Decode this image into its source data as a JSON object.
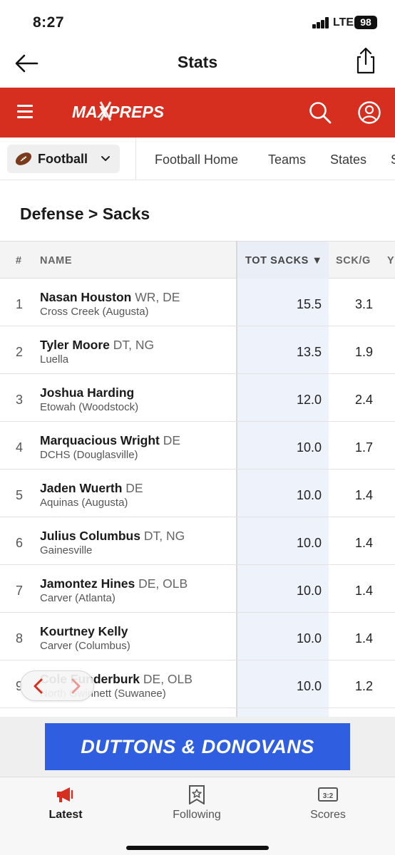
{
  "status_bar": {
    "time": "8:27",
    "network": "LTE",
    "battery": "98"
  },
  "header": {
    "title": "Stats"
  },
  "brand": {
    "logo_text": "MAXPREPS"
  },
  "sport_selector": {
    "selected": "Football",
    "nav_links": [
      "Football Home",
      "Teams",
      "States",
      "S"
    ]
  },
  "section": {
    "title": "Defense > Sacks"
  },
  "table": {
    "columns": {
      "rank": "#",
      "name": "NAME",
      "tot_sacks": "TOT SACKS ▼",
      "sck_g": "SCK/G",
      "next": "Y"
    },
    "rows": [
      {
        "rank": "1",
        "name": "Nasan Houston",
        "pos": "WR, DE",
        "school": "Cross Creek (Augusta)",
        "tot": "15.5",
        "scg": "3.1"
      },
      {
        "rank": "2",
        "name": "Tyler Moore",
        "pos": "DT, NG",
        "school": "Luella",
        "tot": "13.5",
        "scg": "1.9"
      },
      {
        "rank": "3",
        "name": "Joshua Harding",
        "pos": "",
        "school": "Etowah (Woodstock)",
        "tot": "12.0",
        "scg": "2.4"
      },
      {
        "rank": "4",
        "name": "Marquacious Wright",
        "pos": "DE",
        "school": "DCHS (Douglasville)",
        "tot": "10.0",
        "scg": "1.7"
      },
      {
        "rank": "5",
        "name": "Jaden Wuerth",
        "pos": "DE",
        "school": "Aquinas (Augusta)",
        "tot": "10.0",
        "scg": "1.4"
      },
      {
        "rank": "6",
        "name": "Julius Columbus",
        "pos": "DT, NG",
        "school": "Gainesville",
        "tot": "10.0",
        "scg": "1.4"
      },
      {
        "rank": "7",
        "name": "Jamontez Hines",
        "pos": "DE, OLB",
        "school": "Carver (Atlanta)",
        "tot": "10.0",
        "scg": "1.4"
      },
      {
        "rank": "8",
        "name": "Kourtney Kelly",
        "pos": "",
        "school": "Carver (Columbus)",
        "tot": "10.0",
        "scg": "1.4"
      },
      {
        "rank": "9",
        "name": "Cole Funderburk",
        "pos": "DE, OLB",
        "school": "North Gwinnett (Suwanee)",
        "tot": "10.0",
        "scg": "1.2"
      }
    ]
  },
  "ad": {
    "text": "DUTTONS & DONOVANS",
    "color": "#2f5fe0"
  },
  "tab_bar": {
    "latest": "Latest",
    "following": "Following",
    "scores": "Scores"
  },
  "colors": {
    "brand_red": "#d62e1f",
    "sorted_column": "#eef3fb"
  },
  "icons": [
    "back-arrow-icon",
    "share-icon",
    "menu-icon",
    "search-icon",
    "account-icon",
    "football-icon",
    "chevron-down-icon",
    "chevron-left-icon",
    "chevron-right-icon",
    "megaphone-icon",
    "star-bookmark-icon",
    "scoreboard-icon"
  ]
}
